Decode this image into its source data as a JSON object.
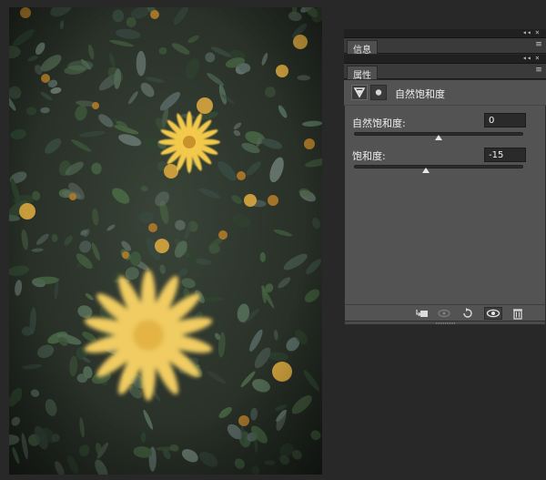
{
  "canvas": {
    "photo_description_icon": "daisy-photo"
  },
  "panels": {
    "info_panel": {
      "tab_label": "信息",
      "collapse_glyph": "◂◂",
      "close_glyph": "×",
      "menu_glyph": "≡"
    },
    "properties_panel": {
      "tab_label": "属性",
      "collapse_glyph": "◂◂",
      "close_glyph": "×",
      "menu_glyph": "≡",
      "adjustment_title": "自然饱和度",
      "vibrance": {
        "label": "自然饱和度:",
        "value": "0",
        "slider_fraction": 0.5
      },
      "saturation": {
        "label": "饱和度:",
        "value": "-15",
        "slider_fraction": 0.425
      },
      "toolbar": {
        "clip_icon": "clip-to-layer-icon",
        "view_previous_icon": "view-previous-state-icon",
        "reset_icon": "reset-icon",
        "visibility_icon": "eye-icon",
        "delete_icon": "trash-icon"
      }
    }
  },
  "colors": {
    "panel_bg": "#535353",
    "tab_bg": "#3a3a3a",
    "input_bg": "#2a2a2a",
    "app_bg": "#282828"
  }
}
